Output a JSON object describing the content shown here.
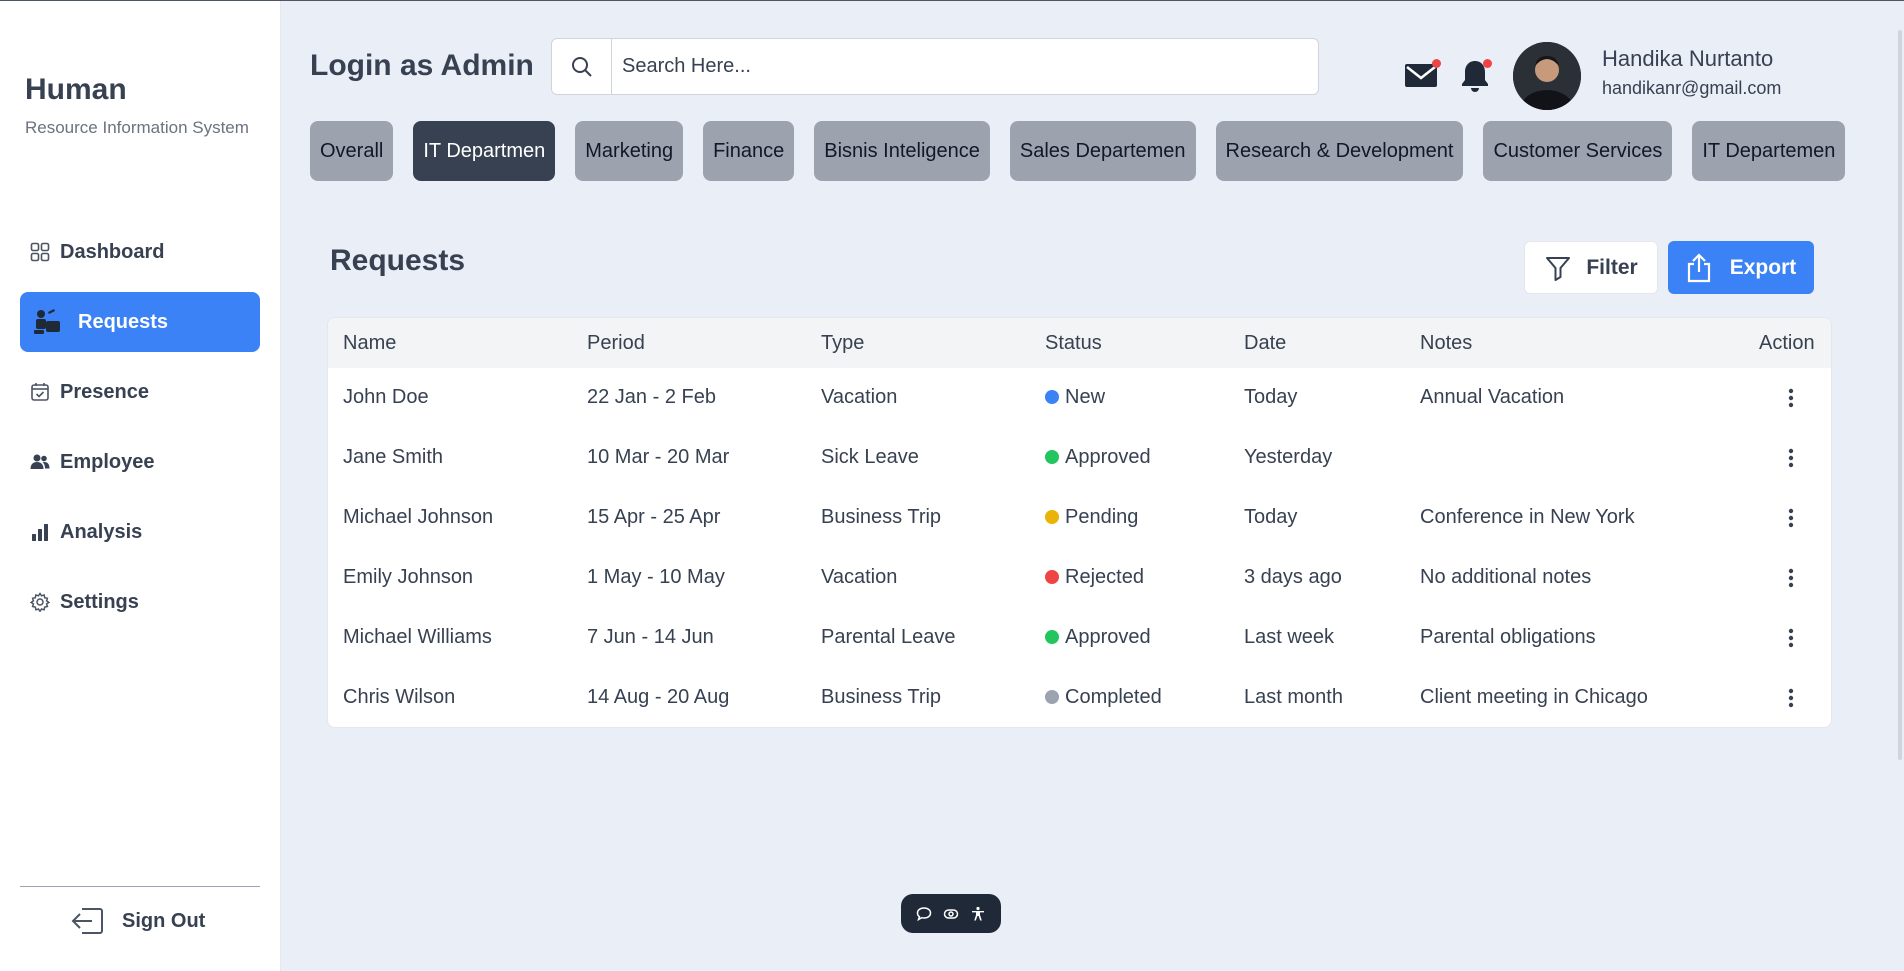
{
  "brand": {
    "title": "Human",
    "subtitle": "Resource Information System"
  },
  "sidebar": {
    "items": [
      {
        "label": "Dashboard",
        "icon": "grid-icon",
        "active": false
      },
      {
        "label": "Requests",
        "icon": "requests-icon",
        "active": true
      },
      {
        "label": "Presence",
        "icon": "calendar-check-icon",
        "active": false
      },
      {
        "label": "Employee",
        "icon": "users-icon",
        "active": false
      },
      {
        "label": "Analysis",
        "icon": "bar-chart-icon",
        "active": false
      },
      {
        "label": "Settings",
        "icon": "gear-icon",
        "active": false
      }
    ],
    "signout_label": "Sign Out"
  },
  "header": {
    "title": "Login as Admin",
    "search_placeholder": "Search Here...",
    "user": {
      "name": "Handika Nurtanto",
      "email": "handikanr@gmail.com"
    }
  },
  "tabs": [
    {
      "label": "Overall",
      "active": false
    },
    {
      "label": "IT Departmen",
      "active": true
    },
    {
      "label": "Marketing",
      "active": false
    },
    {
      "label": "Finance",
      "active": false
    },
    {
      "label": "Bisnis Inteligence",
      "active": false
    },
    {
      "label": "Sales Departemen",
      "active": false
    },
    {
      "label": "Research & Development",
      "active": false
    },
    {
      "label": "Customer Services",
      "active": false
    },
    {
      "label": "IT Departemen",
      "active": false
    }
  ],
  "requests": {
    "title": "Requests",
    "filter_label": "Filter",
    "export_label": "Export",
    "columns": [
      "Name",
      "Period",
      "Type",
      "Status",
      "Date",
      "Notes",
      "Action"
    ],
    "rows": [
      {
        "name": "John Doe",
        "period": "22 Jan - 2 Feb",
        "type": "Vacation",
        "status": "New",
        "status_color": "#3b82f6",
        "date": "Today",
        "notes": "Annual Vacation"
      },
      {
        "name": "Jane Smith",
        "period": "10 Mar - 20 Mar",
        "type": "Sick Leave",
        "status": "Approved",
        "status_color": "#22c55e",
        "date": "Yesterday",
        "notes": ""
      },
      {
        "name": "Michael Johnson",
        "period": "15 Apr - 25 Apr",
        "type": "Business Trip",
        "status": "Pending",
        "status_color": "#eab308",
        "date": "Today",
        "notes": "Conference in New York"
      },
      {
        "name": "Emily Johnson",
        "period": "1 May - 10 May",
        "type": "Vacation",
        "status": "Rejected",
        "status_color": "#ef4444",
        "date": "3 days ago",
        "notes": "No additional notes"
      },
      {
        "name": "Michael Williams",
        "period": "7 Jun - 14 Jun",
        "type": "Parental Leave",
        "status": "Approved",
        "status_color": "#22c55e",
        "date": "Last week",
        "notes": "Parental obligations"
      },
      {
        "name": "Chris Wilson",
        "period": "14 Aug - 20 Aug",
        "type": "Business Trip",
        "status": "Completed",
        "status_color": "#9ca3af",
        "date": "Last month",
        "notes": "Client meeting in Chicago"
      }
    ]
  },
  "colors": {
    "accent": "#3b82f6",
    "notification_dot": "#ef4444",
    "active_tab": "#374151",
    "inactive_tab": "#9ca3af"
  }
}
